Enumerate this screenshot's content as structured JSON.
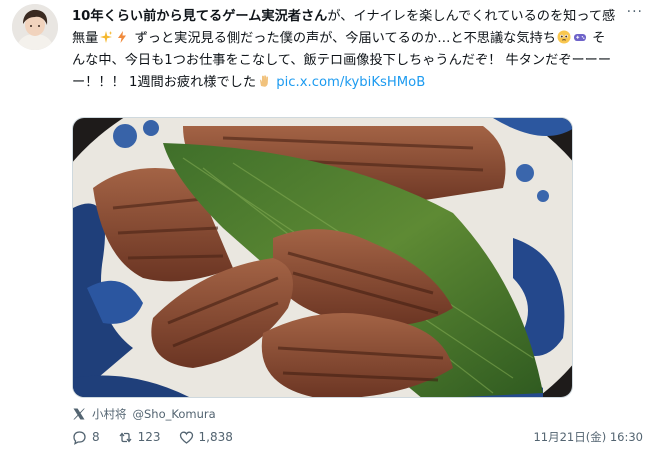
{
  "tweet": {
    "text_bold": "10年くらい前から見てるゲーム実況者さん",
    "text_1": "が、イナイレを楽しんでくれているのを知って感無量",
    "text_2": " ずっと実況見る側だった僕の声が、今届いてるのか…と不思議な気持ち",
    "text_3": " そんな中、今日も1つお仕事をこなして、飯テロ画像投下しちゃうんだぞ！ 牛タンだぞーーーー！！！ 1週間お疲れ様でした",
    "link": "pic.x.com/kybiKsHMoB",
    "emoji_icons": [
      "sparkles-icon",
      "lightning-icon",
      "pleading-face-icon",
      "game-controller-icon",
      "hand-icon"
    ]
  },
  "source": {
    "name": "小村将",
    "handle": "@Sho_Komura"
  },
  "actions": {
    "replies": "8",
    "retweets": "123",
    "likes": "1,838"
  },
  "timestamp": "11月21日(金) 16:30",
  "more_label": "···"
}
